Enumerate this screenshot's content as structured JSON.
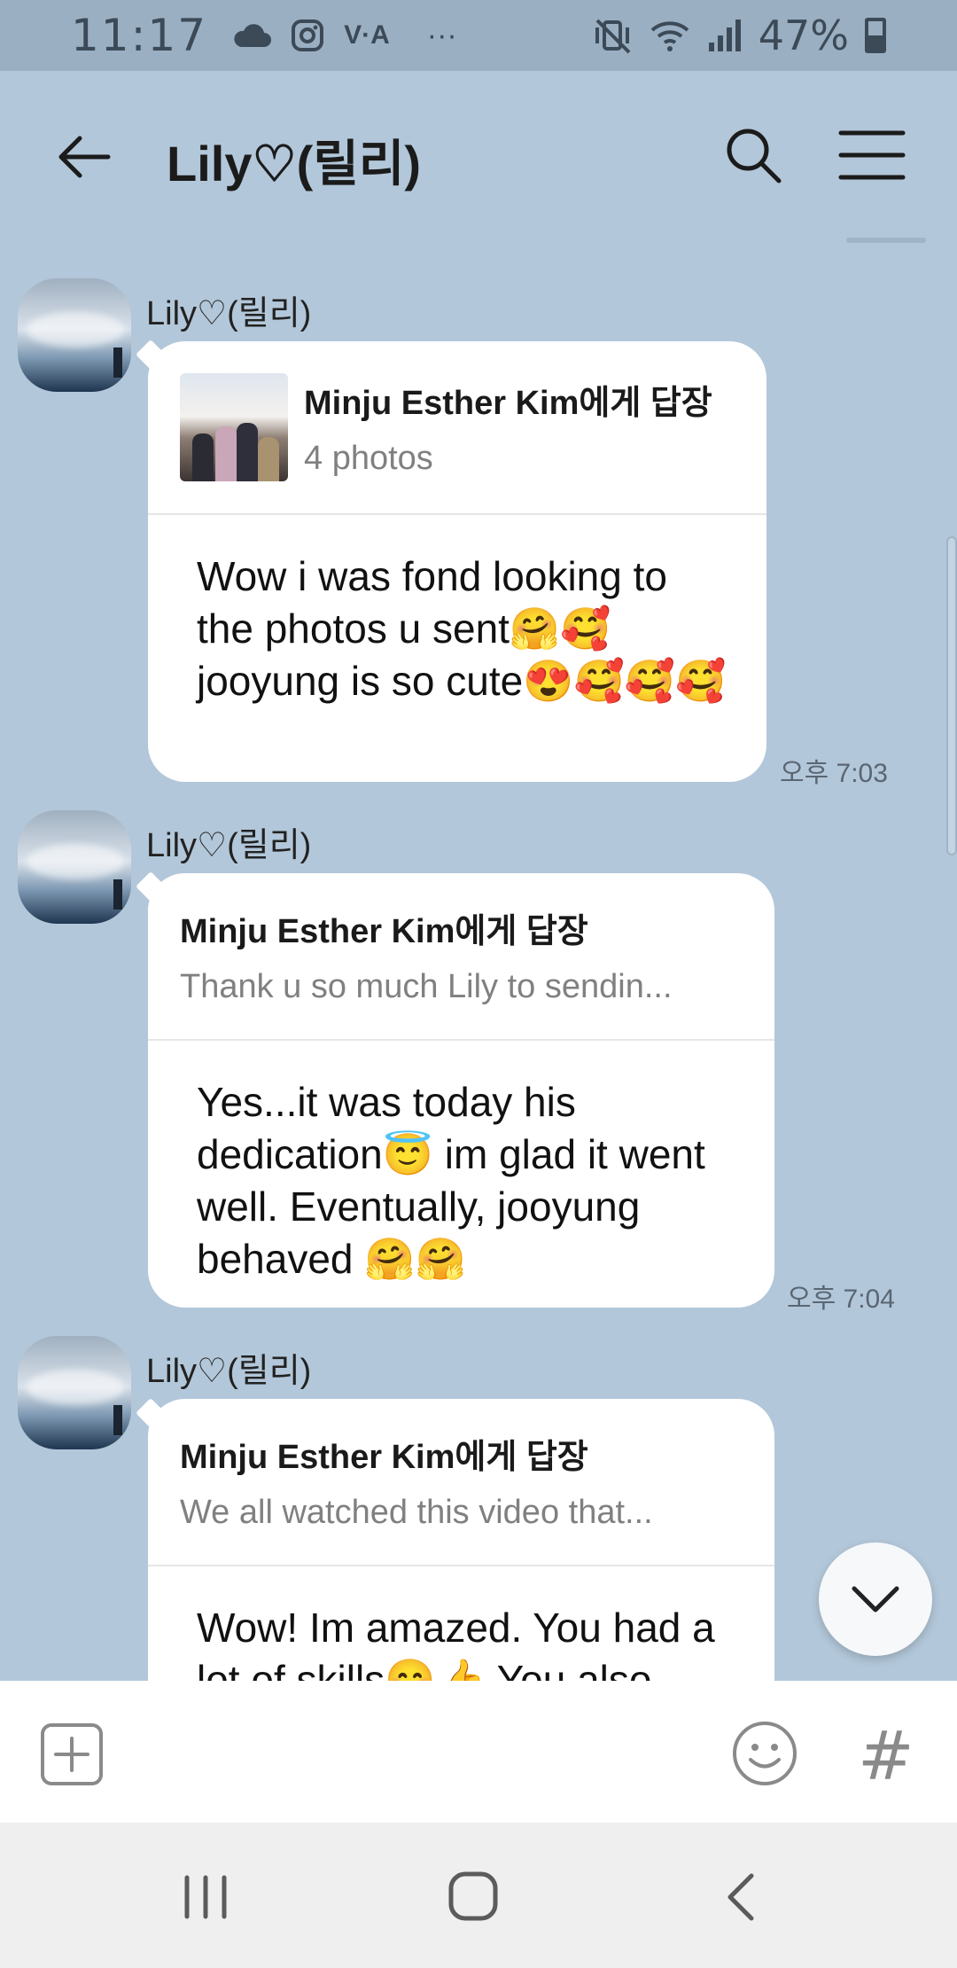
{
  "status_bar": {
    "time": "11:17",
    "left_icons": [
      "cloud-icon",
      "instagram-icon",
      "voa-icon",
      "more-dots-icon"
    ],
    "voa_label": "V·A",
    "more_label": "···",
    "right_icons": [
      "mute-vibrate-icon",
      "wifi-icon",
      "signal-icon",
      "battery-icon"
    ],
    "battery": "47%"
  },
  "header": {
    "title": "Lily♡(릴리)",
    "back_icon": "arrow-left-icon",
    "search_icon": "search-icon",
    "menu_icon": "hamburger-menu-icon"
  },
  "messages": [
    {
      "sender": "Lily♡(릴리)",
      "reply_title": "Minju Esther Kim에게 답장",
      "reply_sub": "4 photos",
      "text": "Wow i was fond looking to the photos u sent🤗🥰jooyung is so cute😍🥰🥰🥰",
      "time": "오후 7:03"
    },
    {
      "sender": "Lily♡(릴리)",
      "reply_title": "Minju Esther Kim에게 답장",
      "reply_sub": "Thank u so much Lily to sendin...",
      "text": "Yes...it was today his dedication😇 im glad it went well. Eventually, jooyung behaved 🤗🤗",
      "time": "오후 7:04"
    },
    {
      "sender": "Lily♡(릴리)",
      "reply_title": "Minju Esther Kim에게 답장",
      "reply_sub": "We all watched this video that...",
      "text": "Wow! Im amazed. You had a lot of skills😊👍 You also"
    }
  ],
  "input_bar": {
    "attach_icon": "plus-square-icon",
    "emoji_icon": "smiley-icon",
    "hash_label": "#"
  },
  "scroll_down_icon": "chevron-down-icon",
  "nav_bar": [
    "recent-apps-icon",
    "home-icon",
    "back-icon"
  ]
}
